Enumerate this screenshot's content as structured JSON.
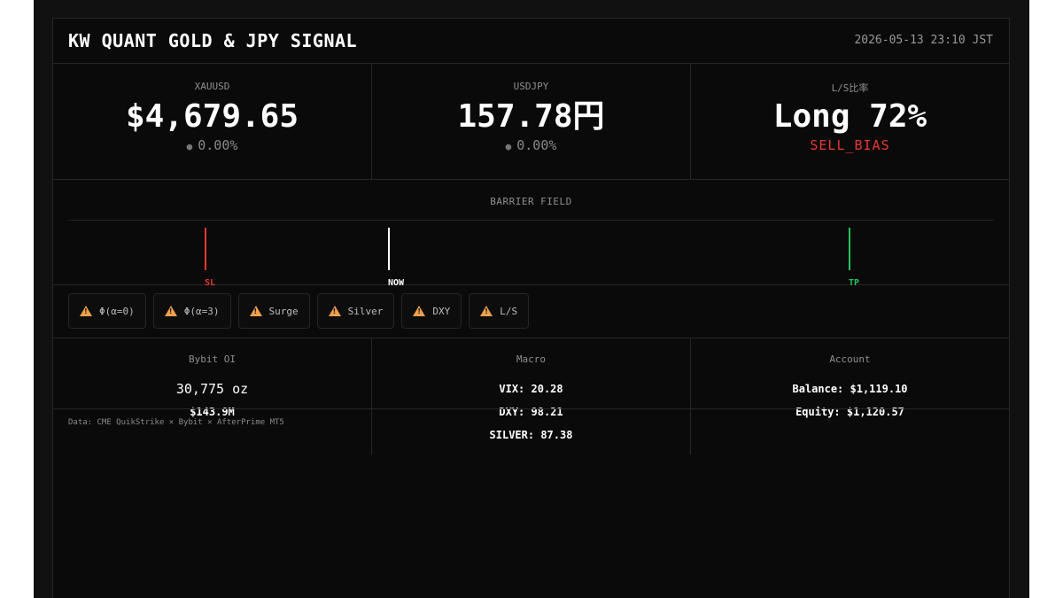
{
  "header": {
    "title": "KW QUANT GOLD & JPY SIGNAL",
    "timestamp": "2026-05-13 23:10 JST"
  },
  "tickers": [
    {
      "label": "XAUUSD",
      "value": "$4,679.65",
      "change": "0.00%"
    },
    {
      "label": "USDJPY",
      "value": "157.78円",
      "change": "0.00%"
    },
    {
      "label": "L/S比率",
      "value": "Long 72%",
      "bias": "SELL_BIAS"
    }
  ],
  "barrier": {
    "title": "BARRIER FIELD",
    "markers": [
      {
        "label": "SL",
        "color": "#e53935"
      },
      {
        "label": "NOW",
        "color": "#ffffff"
      },
      {
        "label": "TP",
        "color": "#22c55e"
      }
    ]
  },
  "alerts": [
    {
      "label": "Φ(α=0)",
      "icon": "warning-icon"
    },
    {
      "label": "Φ(α=3)",
      "icon": "warning-icon"
    },
    {
      "label": "Surge",
      "icon": "warning-icon"
    },
    {
      "label": "Silver",
      "icon": "warning-icon"
    },
    {
      "label": "DXY",
      "icon": "warning-icon"
    },
    {
      "label": "L/S",
      "icon": "warning-icon"
    }
  ],
  "bybit": {
    "title": "Bybit OI",
    "oz": "30,775 oz",
    "usd": "$143.9M"
  },
  "macro": {
    "title": "Macro",
    "vix": "VIX: 20.28",
    "dxy": "DXY: 98.21",
    "silver": "SILVER: 87.38"
  },
  "account": {
    "title": "Account",
    "balance": "Balance: $1,119.10",
    "equity": "Equity: $1,120.57"
  },
  "footnote": "Data: CME QuikStrike × Bybit × AfterPrime MT5",
  "colors": {
    "background": "#0a0a0a",
    "sell_bias": "#e53935",
    "tp": "#22c55e",
    "warning": "#f0a04b"
  }
}
